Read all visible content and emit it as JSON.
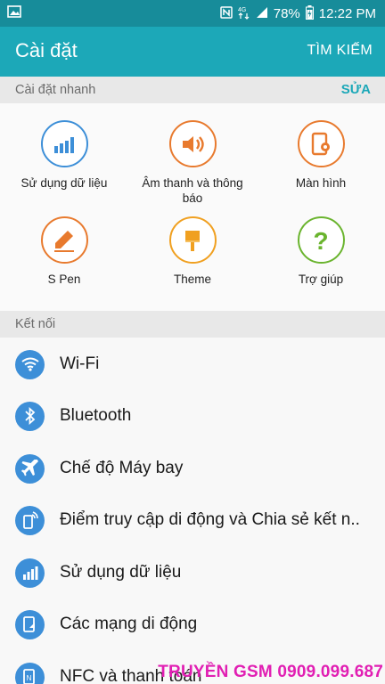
{
  "status_bar": {
    "battery": "78%",
    "time": "12:22 PM"
  },
  "app_bar": {
    "title": "Cài đặt",
    "search_label": "TÌM KIẾM"
  },
  "quick_settings": {
    "header": "Cài đặt nhanh",
    "edit_label": "SỬA",
    "items": [
      {
        "label": "Sử dụng dữ liệu",
        "icon": "data-usage-icon",
        "color": "#3d8fd8"
      },
      {
        "label": "Âm thanh và thông báo",
        "icon": "sound-icon",
        "color": "#e87a2e"
      },
      {
        "label": "Màn hình",
        "icon": "display-icon",
        "color": "#e87a2e"
      },
      {
        "label": "S Pen",
        "icon": "s-pen-icon",
        "color": "#e87a2e"
      },
      {
        "label": "Theme",
        "icon": "theme-brush-icon",
        "color": "#f0a020"
      },
      {
        "label": "Trợ giúp",
        "icon": "help-icon",
        "color": "#6ab42e"
      }
    ]
  },
  "connections": {
    "header": "Kết nối",
    "items": [
      {
        "label": "Wi-Fi",
        "icon": "wifi-icon"
      },
      {
        "label": "Bluetooth",
        "icon": "bluetooth-icon"
      },
      {
        "label": "Chế độ Máy bay",
        "icon": "airplane-icon"
      },
      {
        "label": "Điểm truy cập di động và Chia sẻ kết n..",
        "icon": "hotspot-icon"
      },
      {
        "label": "Sử dụng dữ liệu",
        "icon": "data-usage-icon"
      },
      {
        "label": "Các mạng di động",
        "icon": "mobile-network-icon"
      },
      {
        "label": "NFC và thanh toán",
        "icon": "nfc-icon"
      }
    ],
    "icon_color": "#3d8fd8"
  },
  "watermark": "TRUYỀN GSM 0909.099.687",
  "colors": {
    "app_bar": "#1ca8b8",
    "status_bar": "#178c9a",
    "accent": "#1ca8b8"
  }
}
